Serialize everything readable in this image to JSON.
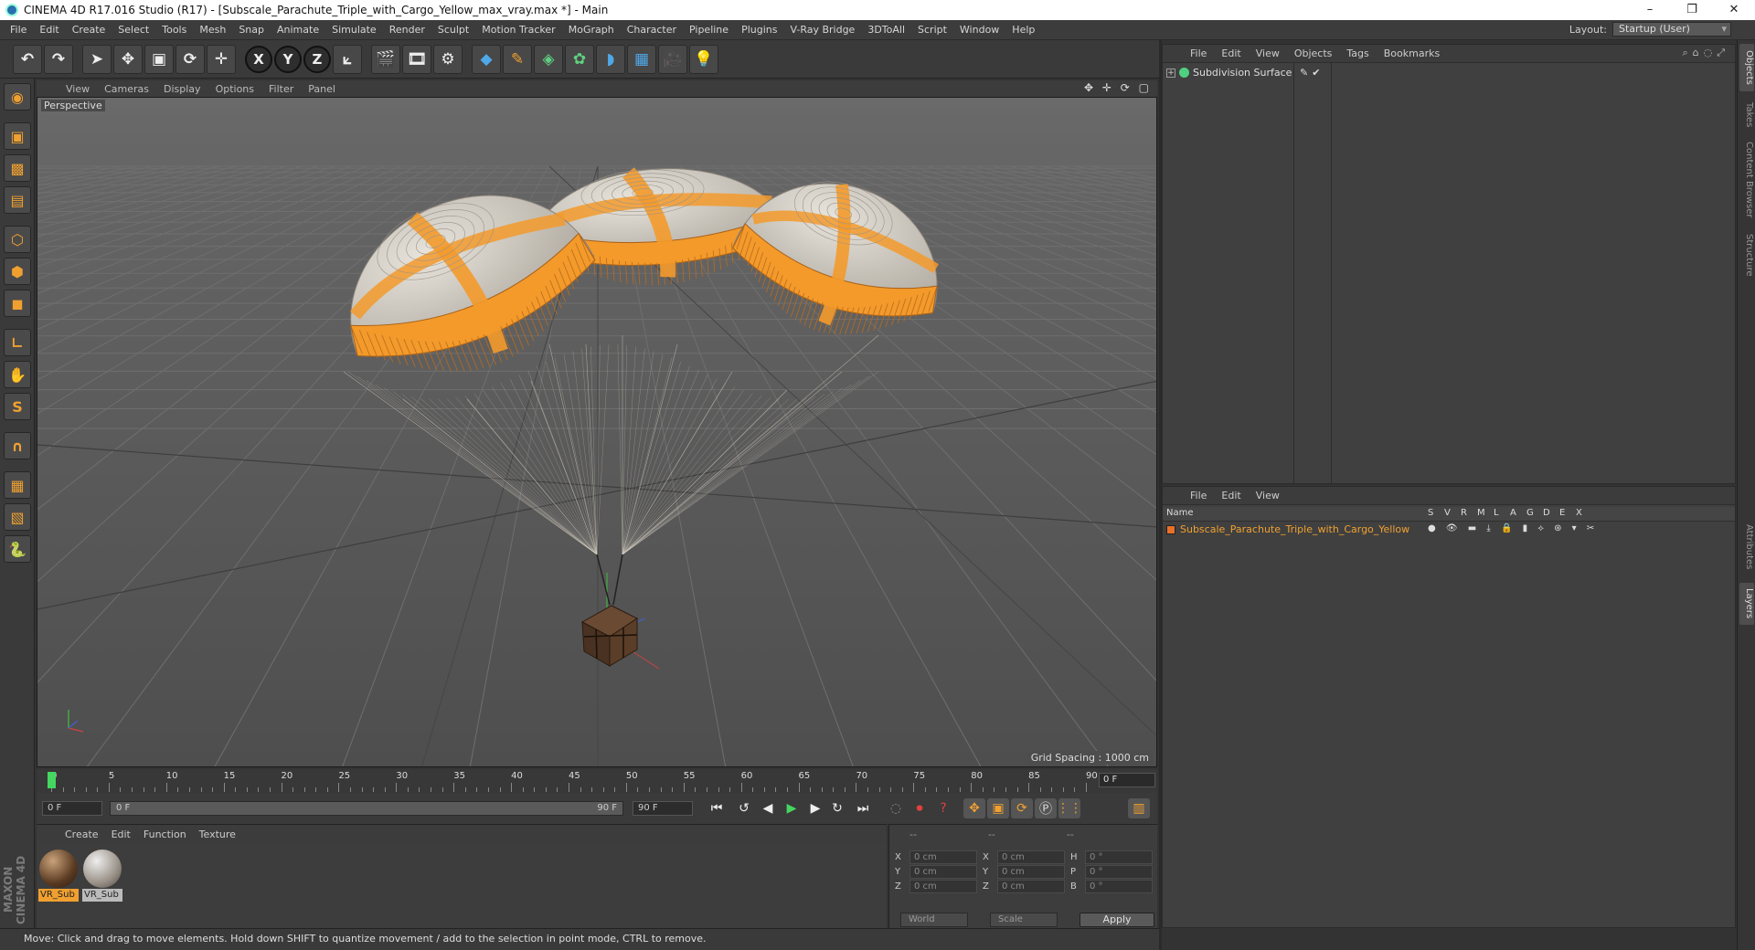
{
  "window": {
    "title": "CINEMA 4D R17.016 Studio (R17) - [Subscale_Parachute_Triple_with_Cargo_Yellow_max_vray.max *] - Main",
    "minimize": "–",
    "restore": "❐",
    "close": "✕"
  },
  "menubar": [
    "File",
    "Edit",
    "Create",
    "Select",
    "Tools",
    "Mesh",
    "Snap",
    "Animate",
    "Simulate",
    "Render",
    "Sculpt",
    "Motion Tracker",
    "MoGraph",
    "Character",
    "Pipeline",
    "Plugins",
    "V-Ray Bridge",
    "3DToAll",
    "Script",
    "Window",
    "Help"
  ],
  "layout": {
    "label": "Layout:",
    "value": "Startup (User)"
  },
  "toolbar": [
    {
      "name": "undo-icon",
      "glyph": "↶"
    },
    {
      "name": "redo-icon",
      "glyph": "↷"
    },
    {
      "name": "select-arrow-icon",
      "glyph": "➤",
      "sep": true
    },
    {
      "name": "move-icon",
      "glyph": "✥"
    },
    {
      "name": "scale-icon",
      "glyph": "▣"
    },
    {
      "name": "rotate-icon",
      "glyph": "⟳"
    },
    {
      "name": "live-selection-icon",
      "glyph": "✛"
    },
    {
      "name": "x-axis-icon",
      "glyph": "X",
      "sep": true,
      "axis": true
    },
    {
      "name": "y-axis-icon",
      "glyph": "Y",
      "axis": true
    },
    {
      "name": "z-axis-icon",
      "glyph": "Z",
      "axis": true
    },
    {
      "name": "coordinate-system-icon",
      "glyph": "⟀"
    },
    {
      "name": "render-view-icon",
      "glyph": "🎬",
      "sep": true
    },
    {
      "name": "render-picture-viewer-icon",
      "glyph": "🎞"
    },
    {
      "name": "render-settings-icon",
      "glyph": "⚙"
    },
    {
      "name": "cube-primitive-icon",
      "glyph": "◆",
      "sep": true,
      "color": "blue"
    },
    {
      "name": "spline-pen-icon",
      "glyph": "✎",
      "color": "orange"
    },
    {
      "name": "subdivision-surface-icon",
      "glyph": "◈",
      "color": "green"
    },
    {
      "name": "array-icon",
      "glyph": "✿",
      "color": "green"
    },
    {
      "name": "deformer-icon",
      "glyph": "◗",
      "color": "blue"
    },
    {
      "name": "floor-icon",
      "glyph": "▦",
      "color": "blue"
    },
    {
      "name": "camera-icon",
      "glyph": "🎥"
    },
    {
      "name": "light-icon",
      "glyph": "💡"
    }
  ],
  "lefttools": [
    {
      "name": "make-editable-icon",
      "glyph": "◉"
    },
    {
      "name": "model-mode-icon",
      "glyph": "▣"
    },
    {
      "name": "texture-mode-icon",
      "glyph": "▩"
    },
    {
      "name": "workplane-icon",
      "glyph": "▤"
    },
    {
      "name": "points-mode-icon",
      "glyph": "⬡"
    },
    {
      "name": "edges-mode-icon",
      "glyph": "⬢"
    },
    {
      "name": "polygons-mode-icon",
      "glyph": "◼"
    },
    {
      "name": "axis-mode-icon",
      "glyph": "∟"
    },
    {
      "name": "tweak-icon",
      "glyph": "✋"
    },
    {
      "name": "solo-icon",
      "glyph": "S"
    },
    {
      "name": "snap-magnet-icon",
      "glyph": "∩"
    },
    {
      "name": "workplane-lock-icon",
      "glyph": "▦"
    },
    {
      "name": "workplane-snap-icon",
      "glyph": "▧"
    },
    {
      "name": "python-icon",
      "glyph": "🐍"
    }
  ],
  "maxon": "MAXON CINEMA 4D",
  "viewport": {
    "menu": [
      "View",
      "Cameras",
      "Display",
      "Options",
      "Filter",
      "Panel"
    ],
    "nav_icons": "✥ ✛ ⟳ ▢",
    "label": "Perspective",
    "grid_spacing": "Grid Spacing : 1000 cm"
  },
  "timeline": {
    "ticks": [
      "0",
      "5",
      "10",
      "15",
      "20",
      "25",
      "30",
      "35",
      "40",
      "45",
      "50",
      "55",
      "60",
      "65",
      "70",
      "75",
      "80",
      "85",
      "90"
    ],
    "frame_display": "0 F"
  },
  "transport": {
    "start_frame": "0 F",
    "slider_start": "0 F",
    "slider_end": "90 F",
    "end_frame": "90 F"
  },
  "material_panel": {
    "menu": [
      "Create",
      "Edit",
      "Function",
      "Texture"
    ],
    "materials": [
      {
        "name": "VR_Sub",
        "selected": true
      },
      {
        "name": "VR_Sub",
        "selected": false
      }
    ]
  },
  "coord_panel": {
    "headers": [
      "--",
      "--",
      "--"
    ],
    "rows": [
      {
        "a": "X",
        "av": "0 cm",
        "b": "X",
        "bv": "0 cm",
        "c": "H",
        "cv": "0 °"
      },
      {
        "a": "Y",
        "av": "0 cm",
        "b": "Y",
        "bv": "0 cm",
        "c": "P",
        "cv": "0 °"
      },
      {
        "a": "Z",
        "av": "0 cm",
        "b": "Z",
        "bv": "0 cm",
        "c": "B",
        "cv": "0 °"
      }
    ],
    "space": "World",
    "mode": "Scale",
    "apply": "Apply"
  },
  "status": "Move: Click and drag to move elements. Hold down SHIFT to quantize movement / add to the selection in point mode, CTRL to remove.",
  "object_manager": {
    "menu": [
      "File",
      "Edit",
      "View",
      "Objects",
      "Tags",
      "Bookmarks"
    ],
    "objects": [
      {
        "name": "Subdivision Surface",
        "tags": "✎✔"
      }
    ]
  },
  "layer_manager": {
    "menu": [
      "File",
      "Edit",
      "View"
    ],
    "header_name": "Name",
    "columns": [
      "S",
      "V",
      "R",
      "M",
      "L",
      "A",
      "G",
      "D",
      "E",
      "X"
    ],
    "layers": [
      {
        "name": "Subscale_Parachute_Triple_with_Cargo_Yellow",
        "icons": "● 👁 ▬ ⤓ 🔒 ▮ ⟡ ⊛ ▾ ✂"
      }
    ]
  },
  "side_tabs": [
    "Objects",
    "Takes",
    "Content Browser",
    "Structure",
    "Attributes",
    "Layers"
  ],
  "colors": {
    "accent": "#f0a030",
    "canopy_orange": "#f39a2b",
    "canopy_white": "#cfcac0",
    "playhead": "#45d660"
  }
}
